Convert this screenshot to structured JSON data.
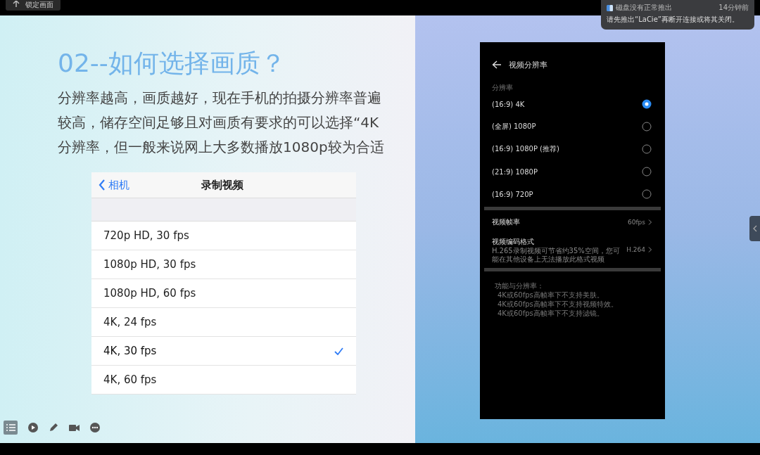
{
  "top_bar": {
    "lock_button": "锁定画面"
  },
  "notification": {
    "title": "磁盘没有正常推出",
    "time": "14分钟前",
    "message": "请先推出“LaCie”再断开连接或将其关闭。"
  },
  "slide": {
    "title": "02--如何选择画质？",
    "body": "分辨率越高，画质越好，现在手机的拍摄分辨率普遍较高，储存空间足够且对画质有要求的可以选择“4K分辨率，但一般来说网上大多数播放1080p较为合适",
    "ios_settings": {
      "back": "相机",
      "title": "录制视频",
      "options": [
        {
          "label": "720p HD, 30 fps",
          "selected": false
        },
        {
          "label": "1080p HD, 30 fps",
          "selected": false
        },
        {
          "label": "1080p HD, 60 fps",
          "selected": false
        },
        {
          "label": "4K, 24 fps",
          "selected": false
        },
        {
          "label": "4K, 30 fps",
          "selected": true
        },
        {
          "label": "4K, 60 fps",
          "selected": false
        }
      ]
    },
    "phone": {
      "title": "视频分辨率",
      "section": "分辨率",
      "resolutions": [
        {
          "label": "(16:9) 4K",
          "selected": true
        },
        {
          "label": "(全屏) 1080P",
          "selected": false
        },
        {
          "label": "(16:9) 1080P (推荐)",
          "selected": false
        },
        {
          "label": "(21:9) 1080P",
          "selected": false
        },
        {
          "label": "(16:9) 720P",
          "selected": false
        }
      ],
      "settings": [
        {
          "label": "视频帧率",
          "value": "60fps"
        },
        {
          "label": "视频编码格式",
          "description": "H.265录制视频可节省约35%空间，您可能在其他设备上无法播放此格式视频",
          "value": "H.264"
        }
      ],
      "notes_heading": "功能与分辨率：",
      "notes": [
        "4K或60fps高帧率下不支持美肤。",
        "4K或60fps高帧率下不支持视频特效。",
        "4K或60fps高帧率下不支持滤镜。"
      ]
    }
  }
}
